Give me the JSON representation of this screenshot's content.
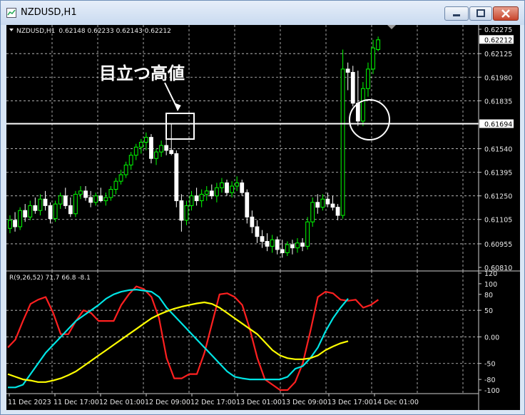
{
  "window": {
    "title": "NZDUSD,H1"
  },
  "chart_data": [
    {
      "type": "candlestick",
      "title": "NZDUSD,H1",
      "ohlc_text": "0.62148 0.62233 0.62143 0.62212",
      "ylim": [
        0.6081,
        0.62275
      ],
      "y_ticks": [
        "0.62275",
        "0.62125",
        "0.61980",
        "0.61835",
        "0.61540",
        "0.61395",
        "0.61250",
        "0.61105",
        "0.60955",
        "0.60810"
      ],
      "current_price": "0.62212",
      "horizontal_line_price": "0.61694",
      "annotation": "目立つ高値",
      "x_ticks": [
        "11 Dec 2023",
        "11 Dec 17:00",
        "12 Dec 01:00",
        "12 Dec 09:00",
        "12 Dec 17:00",
        "13 Dec 01:00",
        "13 Dec 09:00",
        "13 Dec 17:00",
        "14 Dec 01:00"
      ],
      "candles": [
        [
          0.6105,
          0.6113,
          0.6102,
          0.611
        ],
        [
          0.611,
          0.6115,
          0.6103,
          0.6106
        ],
        [
          0.6106,
          0.6118,
          0.6104,
          0.6116
        ],
        [
          0.6116,
          0.612,
          0.6109,
          0.6112
        ],
        [
          0.6112,
          0.6122,
          0.611,
          0.6119
        ],
        [
          0.6119,
          0.6124,
          0.6114,
          0.6116
        ],
        [
          0.6116,
          0.6126,
          0.6113,
          0.6123
        ],
        [
          0.6123,
          0.6128,
          0.6116,
          0.6119
        ],
        [
          0.6119,
          0.6121,
          0.6108,
          0.6111
        ],
        [
          0.6111,
          0.6122,
          0.6109,
          0.612
        ],
        [
          0.612,
          0.6127,
          0.6117,
          0.6125
        ],
        [
          0.6125,
          0.613,
          0.6117,
          0.6119
        ],
        [
          0.6119,
          0.6124,
          0.6112,
          0.6114
        ],
        [
          0.6114,
          0.6128,
          0.6112,
          0.6126
        ],
        [
          0.6126,
          0.6131,
          0.6123,
          0.6128
        ],
        [
          0.6128,
          0.6131,
          0.6122,
          0.6124
        ],
        [
          0.6124,
          0.6128,
          0.6118,
          0.6121
        ],
        [
          0.6121,
          0.6127,
          0.6119,
          0.6125
        ],
        [
          0.6125,
          0.613,
          0.6121,
          0.6122
        ],
        [
          0.6122,
          0.6127,
          0.6119,
          0.6124
        ],
        [
          0.6124,
          0.6131,
          0.6122,
          0.6129
        ],
        [
          0.6129,
          0.6136,
          0.6126,
          0.6134
        ],
        [
          0.6134,
          0.6141,
          0.6132,
          0.6138
        ],
        [
          0.6138,
          0.6146,
          0.6136,
          0.6144
        ],
        [
          0.6144,
          0.6152,
          0.6141,
          0.615
        ],
        [
          0.615,
          0.6157,
          0.6147,
          0.6155
        ],
        [
          0.6155,
          0.616,
          0.6151,
          0.6158
        ],
        [
          0.6158,
          0.6164,
          0.6153,
          0.6161
        ],
        [
          0.6161,
          0.6163,
          0.6145,
          0.6148
        ],
        [
          0.6148,
          0.6154,
          0.6144,
          0.6152
        ],
        [
          0.6152,
          0.6159,
          0.6149,
          0.6156
        ],
        [
          0.6156,
          0.616,
          0.615,
          0.6153
        ],
        [
          0.6153,
          0.6169,
          0.615,
          0.6151
        ],
        [
          0.6151,
          0.6153,
          0.6118,
          0.6122
        ],
        [
          0.6122,
          0.6126,
          0.6103,
          0.611
        ],
        [
          0.611,
          0.6122,
          0.6107,
          0.6119
        ],
        [
          0.6119,
          0.6128,
          0.6116,
          0.6125
        ],
        [
          0.6125,
          0.613,
          0.6119,
          0.6122
        ],
        [
          0.6122,
          0.6129,
          0.6118,
          0.6126
        ],
        [
          0.6126,
          0.6131,
          0.6122,
          0.6128
        ],
        [
          0.6128,
          0.6132,
          0.6123,
          0.6125
        ],
        [
          0.6125,
          0.6133,
          0.6121,
          0.613
        ],
        [
          0.613,
          0.6136,
          0.6127,
          0.6133
        ],
        [
          0.6133,
          0.6135,
          0.6125,
          0.6127
        ],
        [
          0.6127,
          0.6134,
          0.6124,
          0.6131
        ],
        [
          0.6131,
          0.6137,
          0.6128,
          0.6133
        ],
        [
          0.6133,
          0.6135,
          0.6125,
          0.6127
        ],
        [
          0.6127,
          0.6129,
          0.6108,
          0.6112
        ],
        [
          0.6112,
          0.6116,
          0.6102,
          0.6106
        ],
        [
          0.6106,
          0.611,
          0.6096,
          0.61
        ],
        [
          0.61,
          0.6104,
          0.6093,
          0.6097
        ],
        [
          0.6097,
          0.6102,
          0.6091,
          0.6094
        ],
        [
          0.6094,
          0.6101,
          0.609,
          0.6098
        ],
        [
          0.6098,
          0.61,
          0.6089,
          0.6092
        ],
        [
          0.6092,
          0.6098,
          0.6087,
          0.609
        ],
        [
          0.609,
          0.6097,
          0.6088,
          0.6095
        ],
        [
          0.6095,
          0.6098,
          0.6089,
          0.6093
        ],
        [
          0.6093,
          0.6099,
          0.609,
          0.6096
        ],
        [
          0.6096,
          0.6099,
          0.6091,
          0.6094
        ],
        [
          0.6094,
          0.6112,
          0.6092,
          0.6109
        ],
        [
          0.6109,
          0.6124,
          0.6106,
          0.6121
        ],
        [
          0.6121,
          0.6126,
          0.6114,
          0.6118
        ],
        [
          0.6118,
          0.6126,
          0.6116,
          0.6123
        ],
        [
          0.6123,
          0.6127,
          0.6118,
          0.612
        ],
        [
          0.612,
          0.6125,
          0.6116,
          0.6118
        ],
        [
          0.6118,
          0.612,
          0.611,
          0.6113
        ],
        [
          0.6113,
          0.6215,
          0.6111,
          0.6203
        ],
        [
          0.6203,
          0.6207,
          0.619,
          0.6201
        ],
        [
          0.6201,
          0.6205,
          0.618,
          0.6182
        ],
        [
          0.6182,
          0.6202,
          0.6168,
          0.6171
        ],
        [
          0.6171,
          0.6195,
          0.6168,
          0.6191
        ],
        [
          0.6191,
          0.6207,
          0.6186,
          0.6203
        ],
        [
          0.6203,
          0.6221,
          0.62,
          0.6216
        ],
        [
          0.6215,
          0.6223,
          0.6214,
          0.6221
        ]
      ]
    },
    {
      "type": "line",
      "title": "R(9,26,52) 71.7 66.8 -8.1",
      "ylim": [
        -100,
        120
      ],
      "y_ticks": [
        "120",
        "100",
        "80",
        "50",
        "0.00",
        "-50",
        "-80",
        "-100"
      ],
      "series": [
        {
          "color": "#ff2020",
          "values": [
            -20,
            -5,
            30,
            62,
            70,
            75,
            45,
            5,
            5,
            30,
            50,
            45,
            30,
            30,
            30,
            60,
            80,
            95,
            90,
            75,
            35,
            -40,
            -78,
            -78,
            -70,
            -70,
            -30,
            25,
            80,
            82,
            75,
            60,
            15,
            -40,
            -80,
            -90,
            -100,
            -100,
            -85,
            -50,
            10,
            75,
            85,
            82,
            70,
            68,
            70,
            55,
            60,
            70
          ]
        },
        {
          "color": "#00e5e5",
          "values": [
            -95,
            -95,
            -90,
            -70,
            -50,
            -30,
            -15,
            0,
            15,
            30,
            40,
            50,
            60,
            72,
            80,
            85,
            88,
            89,
            87,
            85,
            75,
            55,
            40,
            25,
            10,
            -5,
            -20,
            -35,
            -50,
            -65,
            -75,
            -78,
            -80,
            -80,
            -80,
            -80,
            -80,
            -75,
            -60,
            -55,
            -40,
            -20,
            10,
            35,
            55,
            72
          ]
        },
        {
          "color": "#ffff00",
          "values": [
            -70,
            -75,
            -80,
            -82,
            -85,
            -85,
            -82,
            -78,
            -72,
            -65,
            -55,
            -45,
            -35,
            -25,
            -15,
            -5,
            5,
            15,
            25,
            35,
            42,
            48,
            53,
            57,
            60,
            63,
            65,
            62,
            55,
            45,
            35,
            25,
            15,
            5,
            -10,
            -25,
            -35,
            -40,
            -42,
            -42,
            -40,
            -35,
            -25,
            -18,
            -12,
            -8
          ]
        }
      ]
    }
  ]
}
